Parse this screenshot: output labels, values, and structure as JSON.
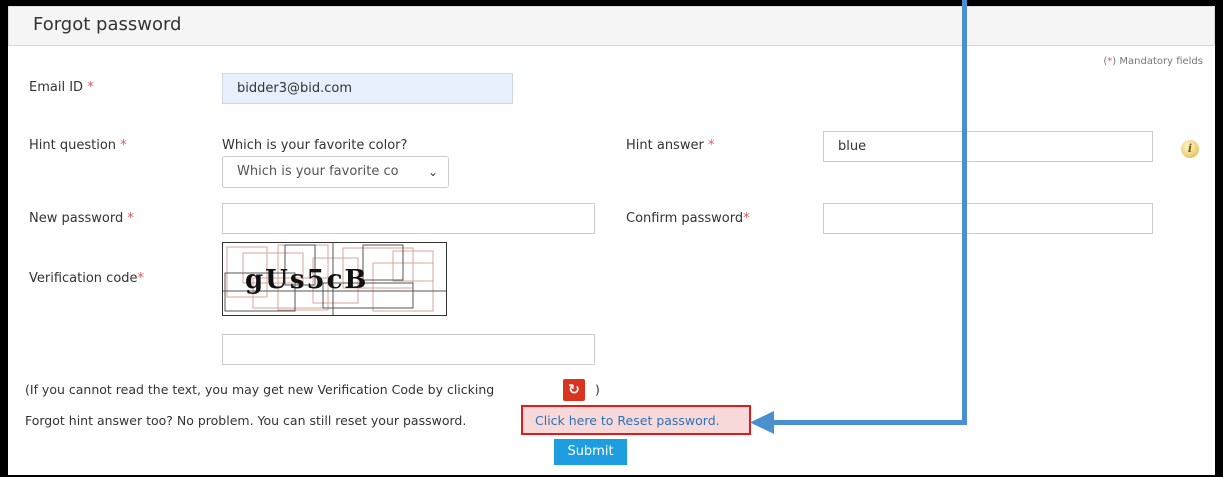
{
  "page": {
    "title": "Forgot password",
    "mandatory_note": "Mandatory fields",
    "mandatory_prefix": "(",
    "mandatory_star": "*",
    "mandatory_suffix": ")"
  },
  "form": {
    "email": {
      "label": "Email ID",
      "value": "bidder3@bid.com"
    },
    "hint_question": {
      "label": "Hint question",
      "question_text": "Which is your favorite color?",
      "selected_option": "Which is your favorite co"
    },
    "hint_answer": {
      "label": "Hint answer",
      "value": "blue"
    },
    "new_password": {
      "label": "New password",
      "value": ""
    },
    "confirm_password": {
      "label": "Confirm password",
      "value": ""
    },
    "verification": {
      "label": "Verification code",
      "captcha_text": "gUs5cB",
      "input_value": ""
    },
    "required_star": "*"
  },
  "messages": {
    "refresh_hint_before": "(If you cannot read the text, you may get new Verification Code by clicking",
    "refresh_hint_after": ")",
    "forgot_hint": "Forgot hint answer too? No problem. You can still reset your password.",
    "reset_link": "Click here to Reset password."
  },
  "buttons": {
    "submit": "Submit"
  },
  "icons": {
    "info": "info-icon",
    "refresh": "refresh-icon",
    "chevron": "chevron-down-icon"
  },
  "colors": {
    "accent": "#1e9de0",
    "highlight_border": "#e01b1b",
    "arrow": "#4b8fd1",
    "link": "#2f71b8",
    "required": "#e05a5a"
  }
}
